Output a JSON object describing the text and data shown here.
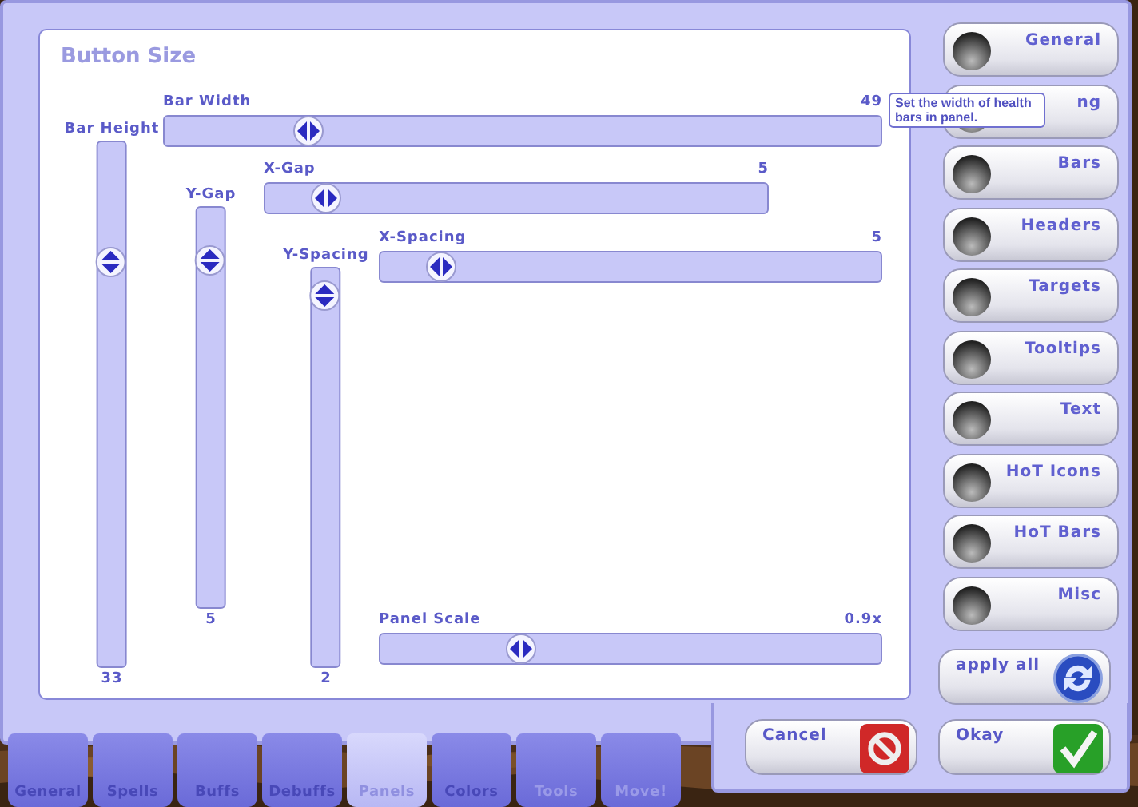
{
  "panel": {
    "title": "Button Size"
  },
  "sliders": [
    {
      "label": "Bar Width",
      "value": "49",
      "kind": "horizontal",
      "level": 0.2
    },
    {
      "label": "Bar Height",
      "value": "33",
      "kind": "vertical",
      "level": 0.77
    },
    {
      "label": "Y-Gap",
      "value": "5",
      "kind": "vertical",
      "level": 0.87
    },
    {
      "label": "X-Gap",
      "value": "5",
      "kind": "horizontal",
      "level": 0.12
    },
    {
      "label": "Y-Spacing",
      "value": "2",
      "kind": "vertical",
      "level": 0.93
    },
    {
      "label": "X-Spacing",
      "value": "5",
      "kind": "horizontal",
      "level": 0.12
    },
    {
      "label": "Panel Scale",
      "value": "0.9x",
      "kind": "horizontal",
      "level": 0.28
    }
  ],
  "tooltip": {
    "text": "Set the width of health bars in panel."
  },
  "sidebar": {
    "items": [
      "General",
      "ng",
      "Bars",
      "Headers",
      "Targets",
      "Tooltips",
      "Text",
      "HoT Icons",
      "HoT Bars",
      "Misc"
    ]
  },
  "actions": [
    {
      "label": "apply all",
      "kind": "apply"
    },
    {
      "label": "Cancel",
      "kind": "cancel"
    },
    {
      "label": "Okay",
      "kind": "okay"
    }
  ],
  "tabs": [
    {
      "label": "General",
      "selected": false,
      "disabled": false
    },
    {
      "label": "Spells",
      "selected": false,
      "disabled": false
    },
    {
      "label": "Buffs",
      "selected": false,
      "disabled": false
    },
    {
      "label": "Debuffs",
      "selected": false,
      "disabled": false
    },
    {
      "label": "Panels",
      "selected": true,
      "disabled": false
    },
    {
      "label": "Colors",
      "selected": false,
      "disabled": false
    },
    {
      "label": "Tools",
      "selected": false,
      "disabled": true
    },
    {
      "label": "Move!",
      "selected": false,
      "disabled": true
    }
  ]
}
